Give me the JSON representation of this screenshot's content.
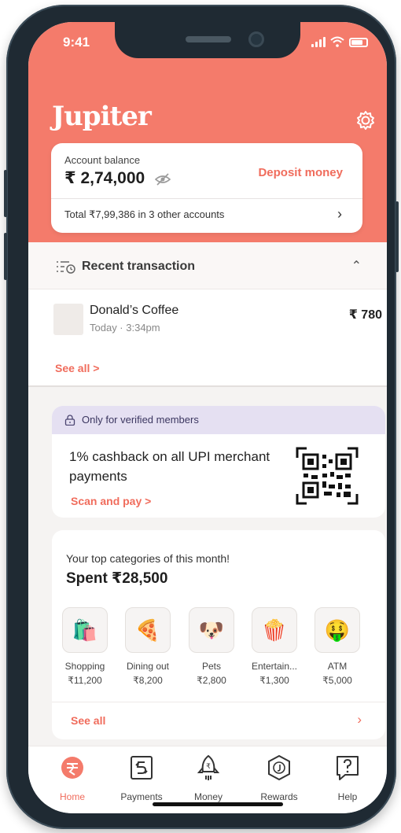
{
  "status": {
    "time": "9:41"
  },
  "header": {
    "logo": "Jupiter"
  },
  "balance": {
    "label": "Account balance",
    "amount": "₹ 2,74,000",
    "deposit_label": "Deposit money",
    "total_text": "Total ₹7,99,386 in 3 other accounts"
  },
  "recent": {
    "title": "Recent transaction",
    "transaction": {
      "name": "Donald’s Coffee",
      "time": "Today · 3:34pm",
      "amount": "₹ 780"
    },
    "see_all": "See all >"
  },
  "promo": {
    "banner": "Only for verified members",
    "text": "1% cashback on all UPI merchant payments",
    "link": "Scan and pay >"
  },
  "categories": {
    "subtitle": "Your top categories of this month!",
    "spent": "Spent ₹28,500",
    "items": [
      {
        "label": "Shopping",
        "amount": "₹11,200",
        "icon": "shopping-bags-icon",
        "glyph": "🛍️"
      },
      {
        "label": "Dining out",
        "amount": "₹8,200",
        "icon": "pizza-icon",
        "glyph": "🍕"
      },
      {
        "label": "Pets",
        "amount": "₹2,800",
        "icon": "dog-icon",
        "glyph": "🐶"
      },
      {
        "label": "Entertain...",
        "amount": "₹1,300",
        "icon": "popcorn-icon",
        "glyph": "🍿"
      },
      {
        "label": "ATM",
        "amount": "₹5,000",
        "icon": "money-face-icon",
        "glyph": "🤑"
      }
    ],
    "see_all": "See all"
  },
  "nav": {
    "items": [
      {
        "label": "Home",
        "icon": "home-icon"
      },
      {
        "label": "Payments",
        "icon": "payments-icon"
      },
      {
        "label": "Money",
        "icon": "rocket-icon"
      },
      {
        "label": "Rewards",
        "icon": "rewards-icon"
      },
      {
        "label": "Help",
        "icon": "help-icon"
      }
    ]
  },
  "colors": {
    "accent": "#f47b6b",
    "link": "#f06c5c",
    "banner": "#e5e0f2"
  }
}
